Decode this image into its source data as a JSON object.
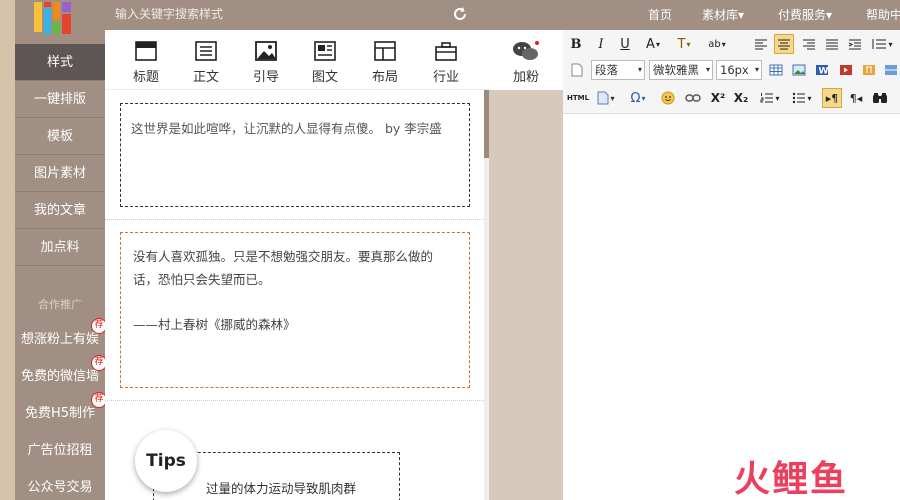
{
  "topbar": {
    "search_placeholder": "输入关键字搜索样式",
    "nav": {
      "home": "首页",
      "materials": "素材库▾",
      "paid": "付费服务▾",
      "help": "帮助中"
    }
  },
  "sidebar": {
    "items": [
      "样式",
      "一键排版",
      "模板",
      "图片素材",
      "我的文章",
      "加点料"
    ],
    "section_title": "合作推广",
    "promo": [
      "想涨粉上有娱",
      "免费的微信墙",
      "免费H5制作",
      "广告位招租",
      "公众号交易"
    ],
    "badge": "荐"
  },
  "categories": [
    "标题",
    "正文",
    "引导",
    "图文",
    "布局",
    "行业"
  ],
  "fans_label": "加粉",
  "style_list": {
    "card1": "这世界是如此喧哗，让沉默的人显得有点傻。 by 李宗盛",
    "card2_line1": "没有人喜欢孤独。只是不想勉强交朋友。要真那么做的话，恐怕只会失望而已。",
    "card2_sig": "——村上春树《挪威的森林》",
    "tips_label": "Tips",
    "tips_text": "过量的体力运动导致肌肉群"
  },
  "editor": {
    "paragraph": "段落",
    "font": "微软雅黑",
    "size": "16px",
    "html": "HTML"
  },
  "watermark": "火鲤鱼",
  "colors": {
    "sidebar": "#a08f82",
    "active": "#5d5654",
    "accent": "#d07030",
    "divider": "#d7c9bc"
  }
}
